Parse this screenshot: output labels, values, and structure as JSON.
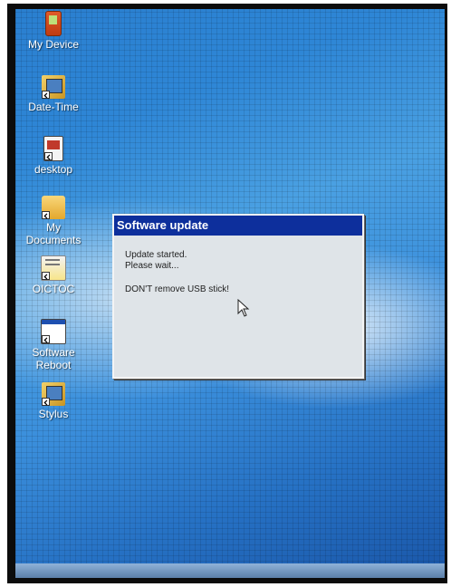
{
  "desktop": {
    "icons": [
      {
        "id": "my-device",
        "label": "My Device",
        "icon": "pda-icon"
      },
      {
        "id": "date-time",
        "label": "Date-Time",
        "icon": "shortcut-folder-icon"
      },
      {
        "id": "desktop",
        "label": "desktop",
        "icon": "desktop-shortcut-icon"
      },
      {
        "id": "my-documents",
        "label": "My Documents",
        "icon": "folder-icon"
      },
      {
        "id": "oictoc",
        "label": "OICTOC",
        "icon": "app-shortcut-icon"
      },
      {
        "id": "software-reboot",
        "label": "Software Reboot",
        "icon": "window-shortcut-icon"
      },
      {
        "id": "stylus",
        "label": "Stylus",
        "icon": "shortcut-folder-icon"
      }
    ]
  },
  "dialog": {
    "title": "Software update",
    "line1": "Update started.",
    "line2": "Please wait...",
    "warning": "DON'T remove USB stick!"
  }
}
